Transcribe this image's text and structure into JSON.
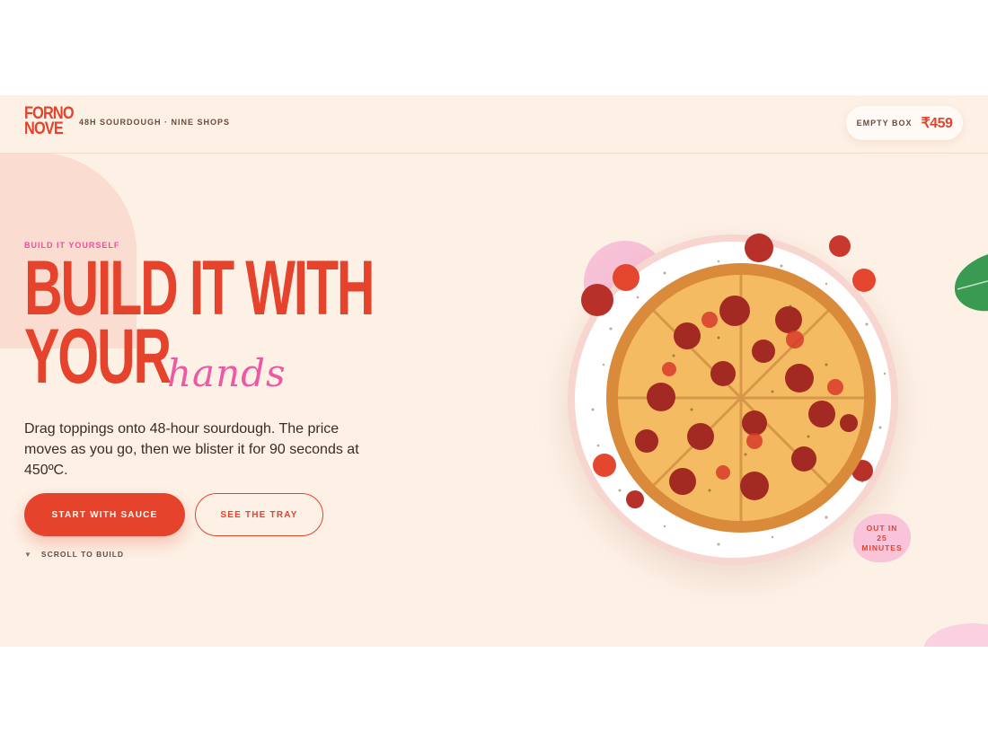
{
  "brand": {
    "logo_line1": "FORNO",
    "logo_line2": "NOVE",
    "tagline": "48H SOURDOUGH · NINE SHOPS"
  },
  "cart": {
    "label": "EMPTY BOX",
    "price": "₹459"
  },
  "hero": {
    "eyebrow": "BUILD IT YOURSELF",
    "headline_line1": "BUILD IT WITH",
    "headline_line2": "YOUR",
    "headline_script": "hands",
    "description": "Drag toppings onto 48-hour sourdough. The price moves as you go, then we blister it for 90 seconds at 450ºC.",
    "primary_cta": "START WITH SAUCE",
    "secondary_cta": "SEE THE TRAY",
    "scroll_hint": "SCROLL TO BUILD"
  },
  "badge": {
    "line1": "OUT IN",
    "line2": "25",
    "line3": "MINUTES"
  },
  "colors": {
    "accent": "#e5432c",
    "pink": "#ee4f9a",
    "cream": "#fdf1e6"
  }
}
